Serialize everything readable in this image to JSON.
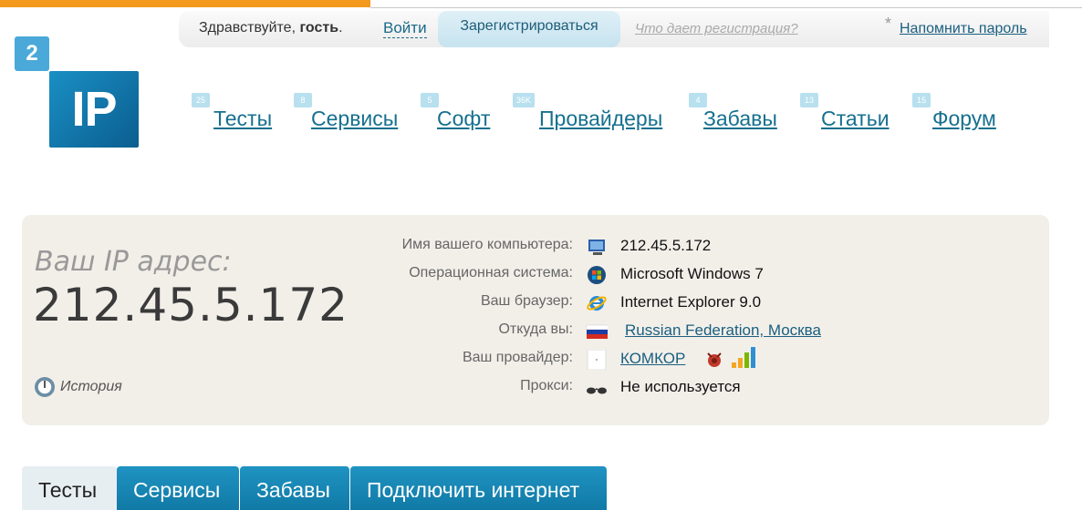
{
  "userbar": {
    "greeting": "Здравствуйте, ",
    "guest": "гость",
    "greeting_end": ".",
    "login": "Войти",
    "register": "Зарегистрироваться",
    "what_gives": "Что дает регистрация?",
    "star": "*",
    "remind_password": "Напомнить пароль"
  },
  "logo": {
    "digit": "2",
    "text": "IP"
  },
  "nav": [
    {
      "badge": "25",
      "label": "Тесты"
    },
    {
      "badge": "8",
      "label": "Сервисы"
    },
    {
      "badge": "5",
      "label": "Софт"
    },
    {
      "badge": "36K",
      "label": "Провайдеры"
    },
    {
      "badge": "4",
      "label": "Забавы"
    },
    {
      "badge": "13",
      "label": "Статьи"
    },
    {
      "badge": "15",
      "label": "Форум"
    }
  ],
  "ip": {
    "title": "Ваш IP адрес:",
    "value": "212.45.5.172",
    "history": "История"
  },
  "info": [
    {
      "label": "Имя вашего компьютера:",
      "icon": "computer-icon",
      "value": "212.45.5.172"
    },
    {
      "label": "Операционная система:",
      "icon": "windows-icon",
      "value": "Microsoft Windows 7"
    },
    {
      "label": "Ваш браузер:",
      "icon": "ie-icon",
      "value": "Internet Explorer 9.0"
    },
    {
      "label": "Откуда вы:",
      "icon": "russia-flag-icon",
      "value": "Russian Federation, Москва"
    },
    {
      "label": "Ваш провайдер:",
      "icon": "provider-logo-icon",
      "value": "КОМКОР"
    },
    {
      "label": "Прокси:",
      "icon": "glasses-icon",
      "value": "Не используется"
    }
  ],
  "tabs": [
    {
      "label": "Тесты"
    },
    {
      "label": "Сервисы"
    },
    {
      "label": "Забавы"
    },
    {
      "label": "Подключить интернет"
    }
  ]
}
